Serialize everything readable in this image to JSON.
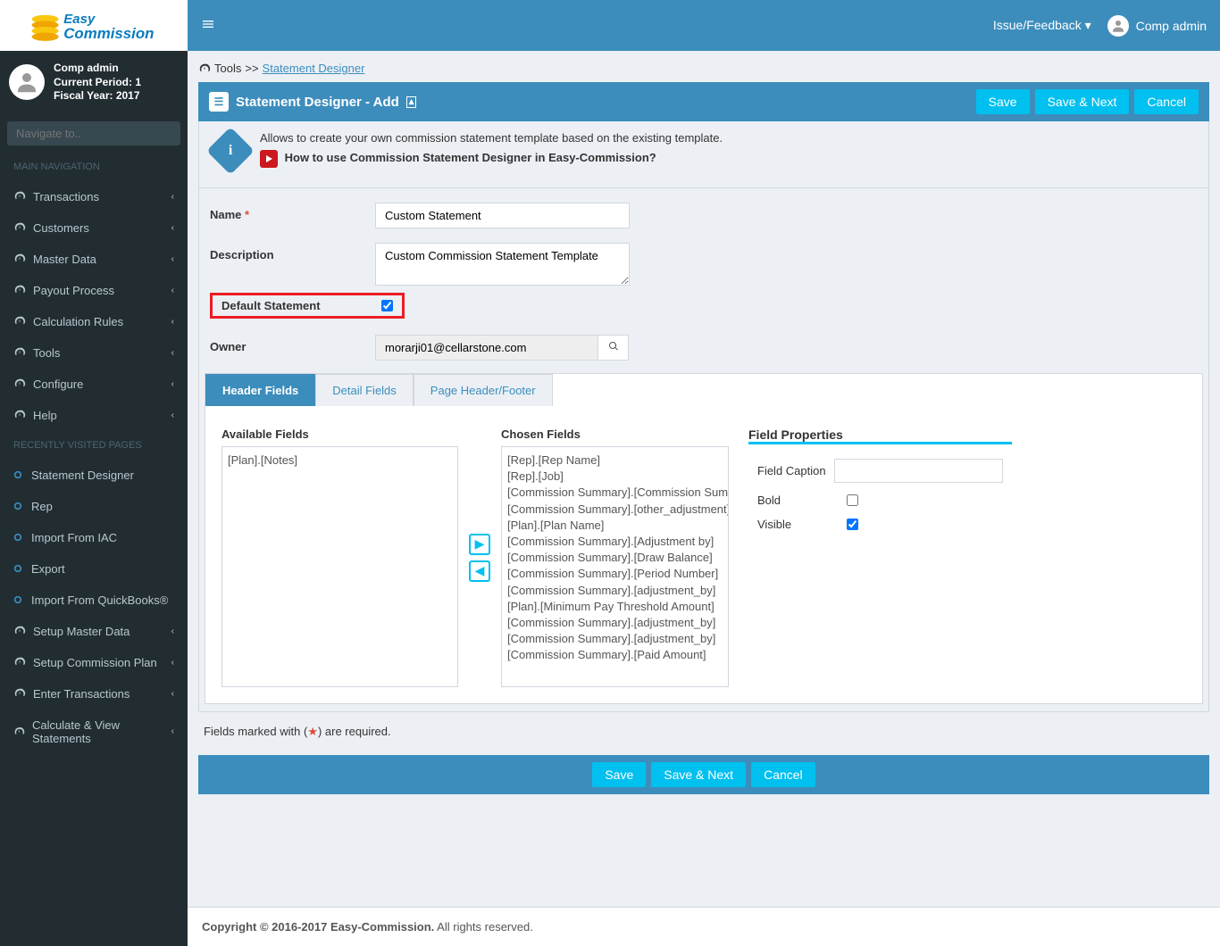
{
  "brand": {
    "name1": "Easy",
    "name2": "Commission"
  },
  "user": {
    "name": "Comp admin",
    "period": "Current Period: 1",
    "fiscal": "Fiscal Year: 2017"
  },
  "search": {
    "placeholder": "Navigate to.."
  },
  "nav_header": "MAIN NAVIGATION",
  "nav_items": [
    "Transactions",
    "Customers",
    "Master Data",
    "Payout Process",
    "Calculation Rules",
    "Tools",
    "Configure",
    "Help"
  ],
  "recent_header": "RECENTLY VISITED PAGES",
  "recent_items": [
    "Statement Designer",
    "Rep",
    "Import From IAC",
    "Export",
    "Import From QuickBooks®"
  ],
  "setup_items": [
    "Setup Master Data",
    "Setup Commission Plan",
    "Enter Transactions",
    "Calculate & View Statements"
  ],
  "topbar": {
    "feedback": "Issue/Feedback",
    "user": "Comp admin"
  },
  "breadcrumb": {
    "section": "Tools",
    "page": "Statement Designer"
  },
  "panel": {
    "title": "Statement Designer - Add"
  },
  "actions": {
    "save": "Save",
    "save_next": "Save & Next",
    "cancel": "Cancel"
  },
  "info": {
    "line1": "Allows to create your own commission statement template based on the existing template.",
    "line2": "How to use Commission Statement Designer in Easy-Commission?"
  },
  "form": {
    "name_label": "Name",
    "name_value": "Custom Statement",
    "desc_label": "Description",
    "desc_value": "Custom Commission Statement Template",
    "default_label": "Default Statement",
    "owner_label": "Owner",
    "owner_value": "morarji01@cellarstone.com"
  },
  "tabs": [
    "Header Fields",
    "Detail Fields",
    "Page Header/Footer"
  ],
  "fields": {
    "available_label": "Available Fields",
    "chosen_label": "Chosen Fields",
    "props_label": "Field Properties",
    "available": [
      "[Plan].[Notes]"
    ],
    "chosen": [
      "[Rep].[Rep Name]",
      "[Rep].[Job]",
      "[Commission Summary].[Commission Summary]",
      "[Commission Summary].[other_adjustment]",
      "[Plan].[Plan Name]",
      "[Commission Summary].[Adjustment by]",
      "[Commission Summary].[Draw Balance]",
      "[Commission Summary].[Period Number]",
      "[Commission Summary].[adjustment_by]",
      "[Plan].[Minimum Pay Threshold Amount]",
      "[Commission Summary].[adjustment_by]",
      "[Commission Summary].[adjustment_by]",
      "[Commission Summary].[Paid Amount]"
    ]
  },
  "props": {
    "caption": "Field Caption",
    "bold": "Bold",
    "visible": "Visible"
  },
  "req_note_a": "Fields marked with (",
  "req_note_b": ") are required.",
  "footer": {
    "bold": "Copyright © 2016-2017 Easy-Commission.",
    "rest": " All rights reserved."
  }
}
